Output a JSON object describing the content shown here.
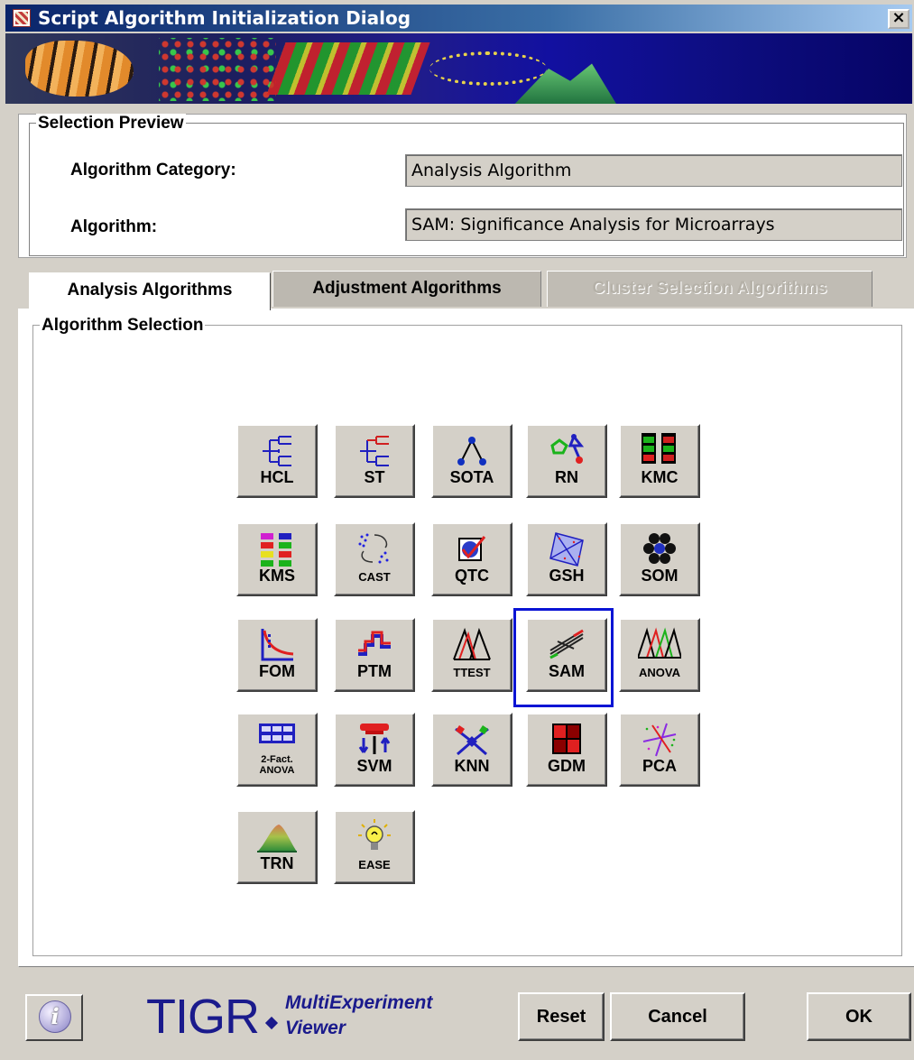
{
  "window": {
    "title": "Script Algorithm Initialization Dialog",
    "close_glyph": "×"
  },
  "preview": {
    "group_title": "Selection Preview",
    "category_label": "Algorithm Category:",
    "category_value": "Analysis Algorithm",
    "algorithm_label": "Algorithm:",
    "algorithm_value": "SAM: Significance Analysis for Microarrays"
  },
  "tabs": [
    {
      "label": "Analysis Algorithms",
      "state": "active"
    },
    {
      "label": "Adjustment Algorithms",
      "state": "inactive"
    },
    {
      "label": "Cluster Selection Algorithms",
      "state": "disabled"
    }
  ],
  "algorithms": {
    "group_title": "Algorithm Selection",
    "selected": "SAM",
    "items": [
      {
        "label": "HCL",
        "icon": "hcl-tree-icon"
      },
      {
        "label": "ST",
        "icon": "support-tree-icon"
      },
      {
        "label": "SOTA",
        "icon": "sota-network-icon"
      },
      {
        "label": "RN",
        "icon": "relevance-network-icon"
      },
      {
        "label": "KMC",
        "icon": "kmc-blocks-icon"
      },
      {
        "label": "KMS",
        "icon": "kms-blocks-icon"
      },
      {
        "label": "CAST",
        "icon": "cast-scatter-icon"
      },
      {
        "label": "QTC",
        "icon": "qtc-check-icon"
      },
      {
        "label": "GSH",
        "icon": "gsh-scatter-icon"
      },
      {
        "label": "SOM",
        "icon": "som-hex-icon"
      },
      {
        "label": "FOM",
        "icon": "fom-curve-icon"
      },
      {
        "label": "PTM",
        "icon": "ptm-template-icon"
      },
      {
        "label": "TTEST",
        "icon": "ttest-distribution-icon"
      },
      {
        "label": "SAM",
        "icon": "sam-plot-icon"
      },
      {
        "label": "ANOVA",
        "icon": "anova-distribution-icon"
      },
      {
        "label": "2-Fact.\nANOVA",
        "icon": "two-factor-anova-grid-icon"
      },
      {
        "label": "SVM",
        "icon": "svm-hyperplane-icon"
      },
      {
        "label": "KNN",
        "icon": "knn-neighbors-icon"
      },
      {
        "label": "GDM",
        "icon": "gdm-matrix-icon"
      },
      {
        "label": "PCA",
        "icon": "pca-scatter-icon"
      },
      {
        "label": "TRN",
        "icon": "terrain-icon"
      },
      {
        "label": "EASE",
        "icon": "ease-lightbulb-icon"
      }
    ]
  },
  "footer": {
    "logo_main": "TIGR",
    "logo_line1": "MultiExperiment",
    "logo_line2": "Viewer",
    "info_glyph": "i",
    "reset_label": "Reset",
    "cancel_label": "Cancel",
    "ok_label": "OK"
  }
}
